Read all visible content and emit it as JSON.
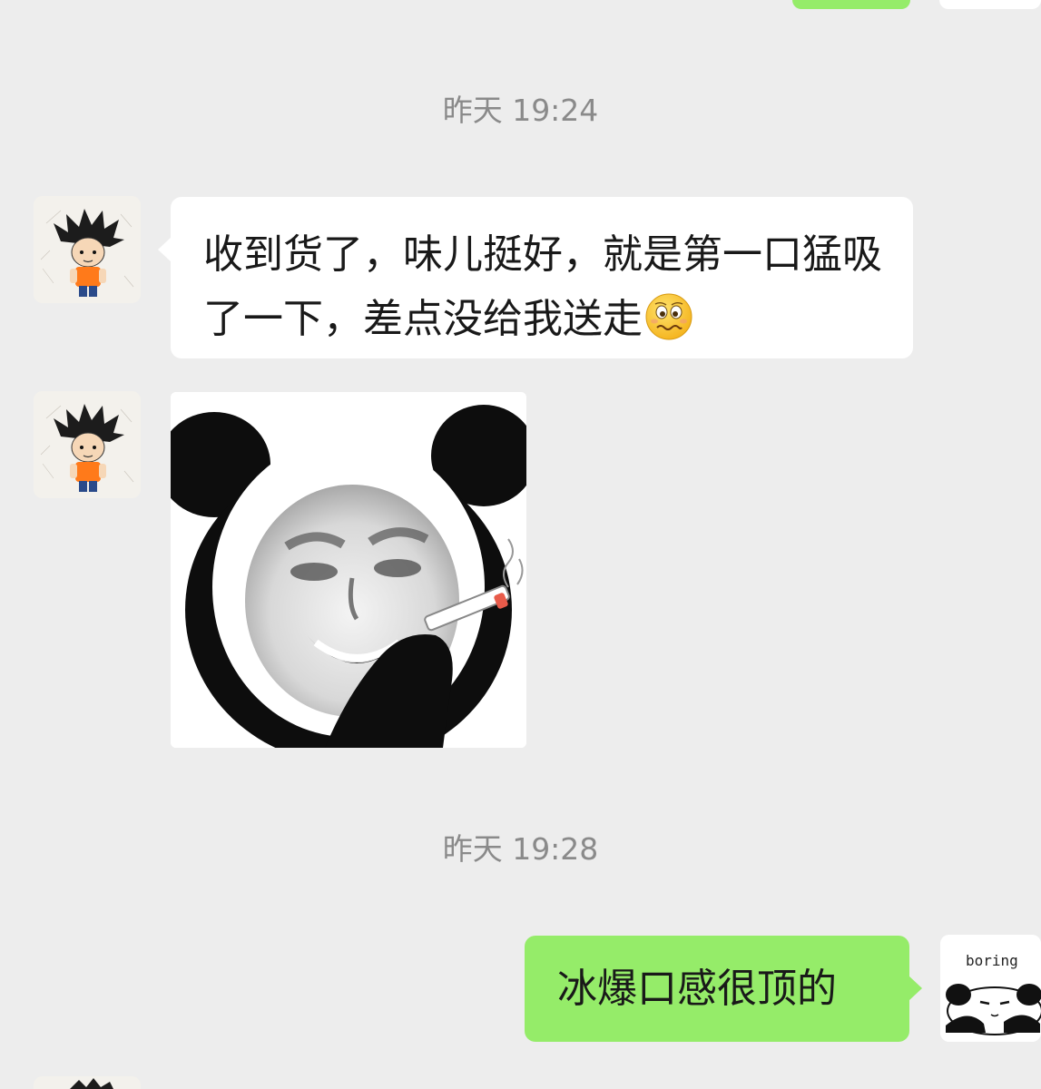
{
  "chat": {
    "timestamps": [
      "昨天 19:24",
      "昨天 19:28"
    ],
    "messages": [
      {
        "direction": "incoming",
        "type": "text",
        "text": "收到货了，味儿挺好，就是第一口猛吸了一下，差点没给我送走",
        "emoji": "woozy-face-icon"
      },
      {
        "direction": "incoming",
        "type": "sticker",
        "sticker": "panda-smoking-sticker"
      },
      {
        "direction": "outgoing",
        "type": "text",
        "text": "冰爆口感很顶的"
      }
    ],
    "self_avatar_text": "boring"
  },
  "colors": {
    "background": "#ededed",
    "incoming_bubble": "#ffffff",
    "outgoing_bubble": "#95ec69",
    "timestamp_text": "#8a8a8a",
    "message_text": "#191919"
  }
}
